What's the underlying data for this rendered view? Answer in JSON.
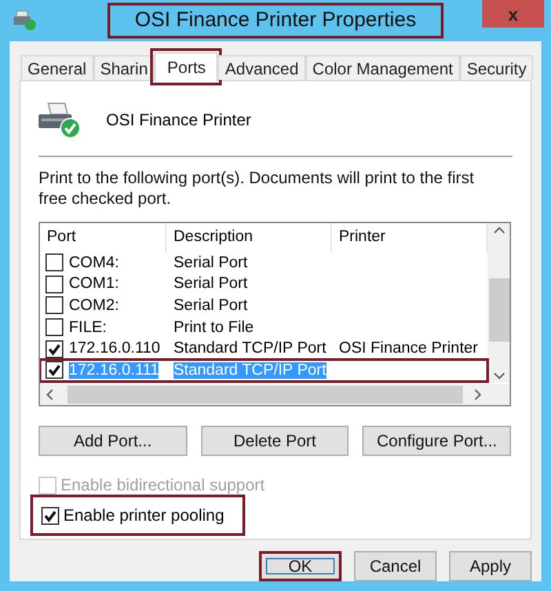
{
  "window": {
    "title": "OSI Finance Printer Properties",
    "highlighted": true,
    "close_label": "x"
  },
  "tabs": [
    {
      "label": "General",
      "selected": false,
      "highlighted": false
    },
    {
      "label": "Sharin",
      "selected": false,
      "highlighted": false
    },
    {
      "label": "Ports",
      "selected": true,
      "highlighted": true
    },
    {
      "label": "Advanced",
      "selected": false,
      "highlighted": false
    },
    {
      "label": "Color Management",
      "selected": false,
      "highlighted": false
    },
    {
      "label": "Security",
      "selected": false,
      "highlighted": false
    }
  ],
  "printer_name": "OSI Finance Printer",
  "instructions": "Print to the following port(s). Documents will print to the first free checked port.",
  "ports": {
    "columns": [
      "Port",
      "Description",
      "Printer"
    ],
    "rows": [
      {
        "port": "COM4:",
        "description": "Serial Port",
        "printer": "",
        "checked": false,
        "selected": false,
        "highlighted": false
      },
      {
        "port": "COM1:",
        "description": "Serial Port",
        "printer": "",
        "checked": false,
        "selected": false,
        "highlighted": false
      },
      {
        "port": "COM2:",
        "description": "Serial Port",
        "printer": "",
        "checked": false,
        "selected": false,
        "highlighted": false
      },
      {
        "port": "FILE:",
        "description": "Print to File",
        "printer": "",
        "checked": false,
        "selected": false,
        "highlighted": false
      },
      {
        "port": "172.16.0.110",
        "description": "Standard TCP/IP Port",
        "printer": "OSI Finance Printer",
        "checked": true,
        "selected": false,
        "highlighted": false
      },
      {
        "port": "172.16.0.111",
        "description": "Standard TCP/IP Port",
        "printer": "",
        "checked": true,
        "selected": true,
        "highlighted": true
      }
    ]
  },
  "port_buttons": [
    "Add Port...",
    "Delete Port",
    "Configure Port..."
  ],
  "options": [
    {
      "label": "Enable bidirectional support",
      "checked": false,
      "disabled": true,
      "highlighted": false
    },
    {
      "label": "Enable printer pooling",
      "checked": true,
      "disabled": false,
      "highlighted": true
    }
  ],
  "dialog_buttons": [
    {
      "label": "OK",
      "highlighted": true
    },
    {
      "label": "Cancel",
      "highlighted": false
    },
    {
      "label": "Apply",
      "highlighted": false
    }
  ]
}
